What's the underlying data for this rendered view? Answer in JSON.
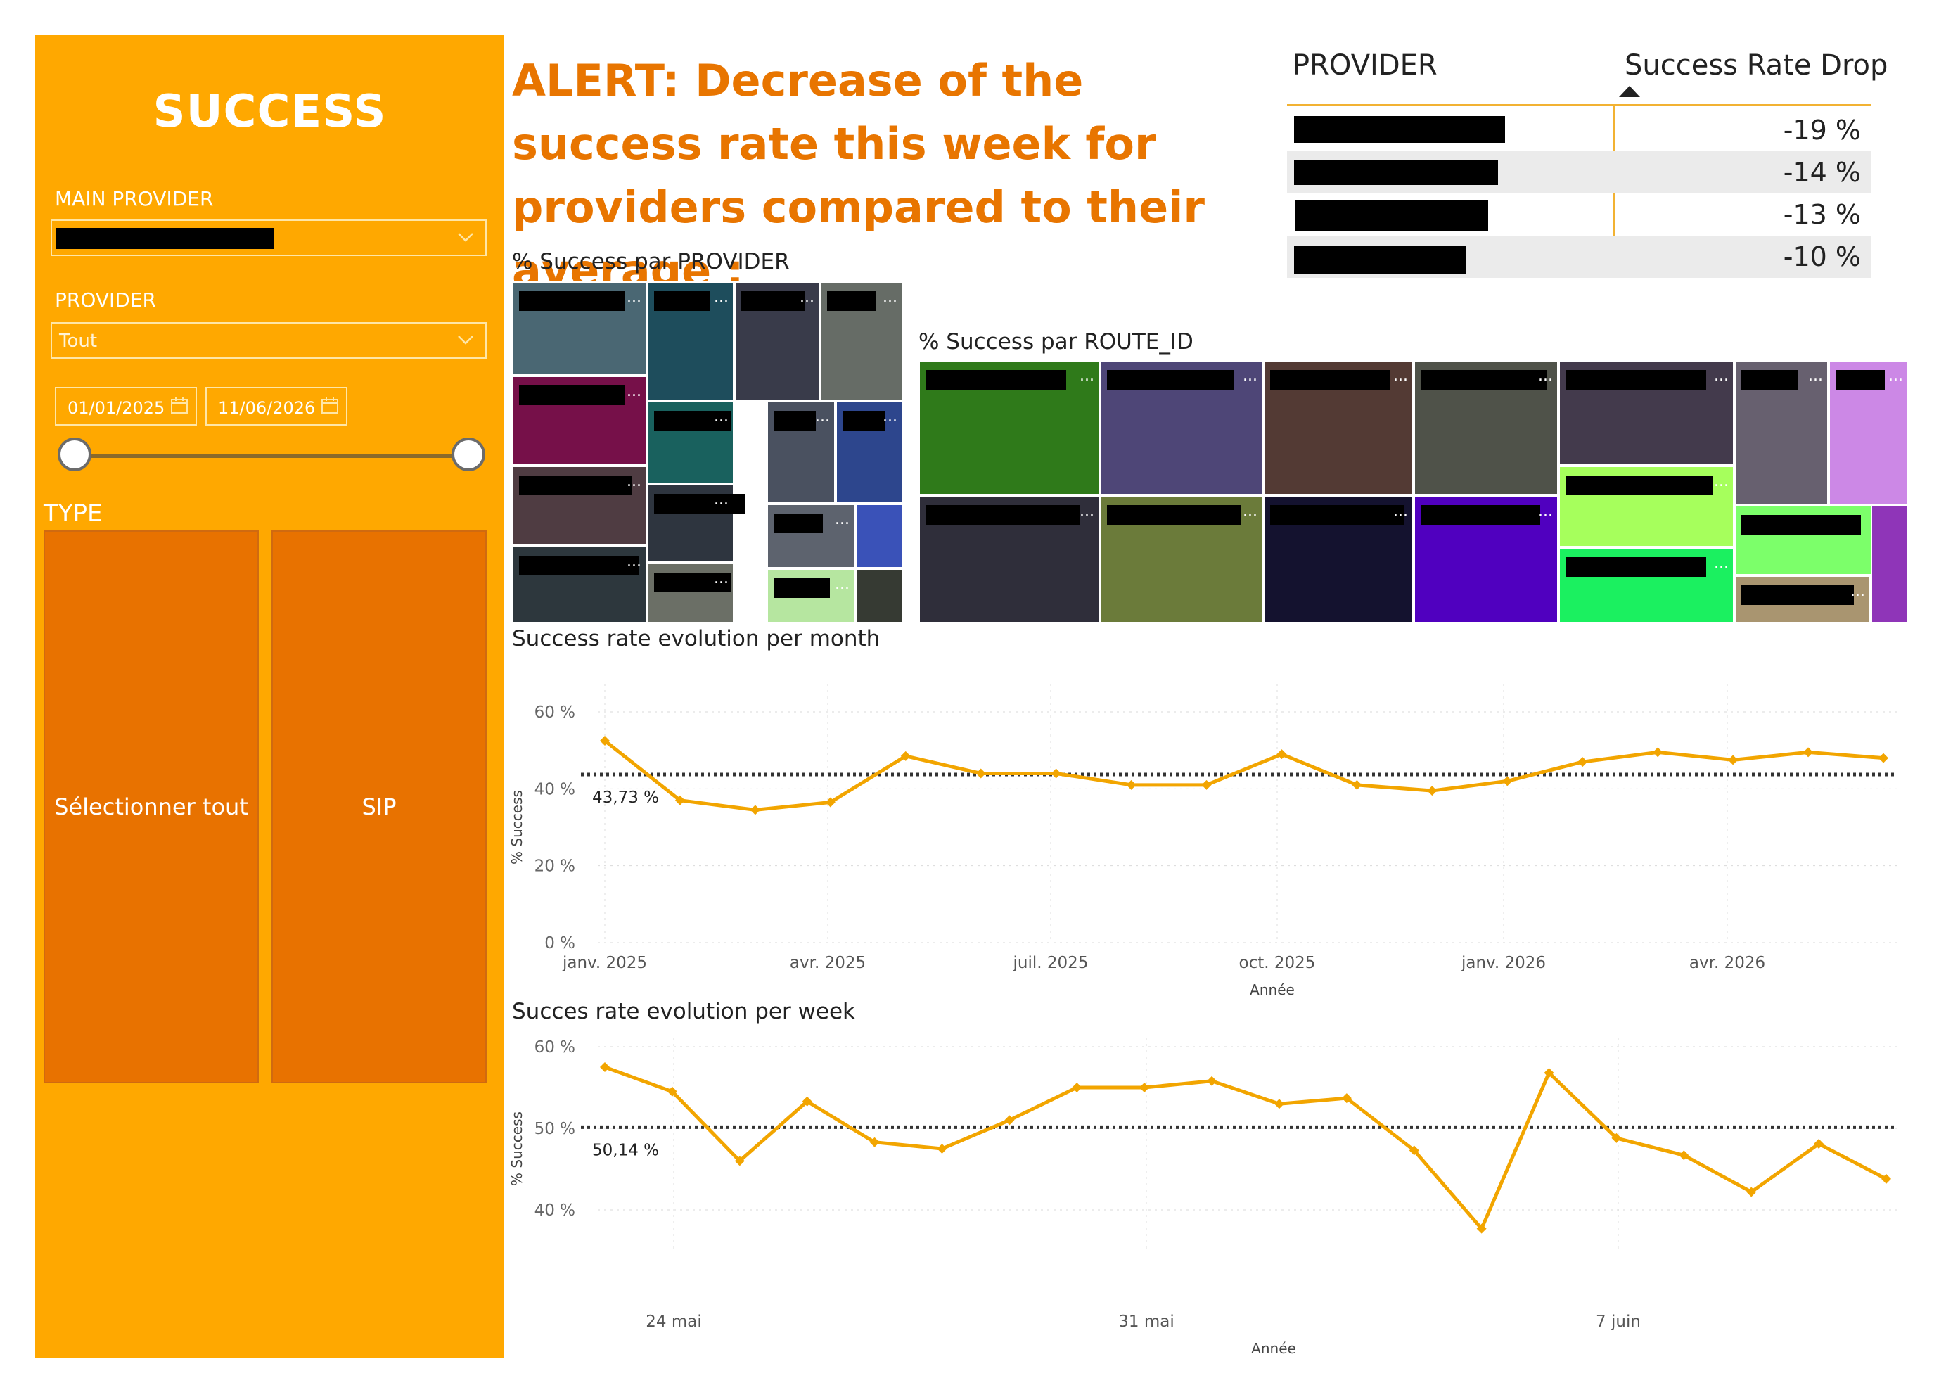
{
  "sidebar": {
    "title": "SUCCESS",
    "main_provider_label": "MAIN PROVIDER",
    "provider_label": "PROVIDER",
    "provider_value": "Tout",
    "date_start": "01/01/2025",
    "date_end": "11/06/2026",
    "type_label": "TYPE",
    "type_options": [
      "Sélectionner tout",
      "SIP"
    ]
  },
  "alert_text": "ALERT: Decrease of the success rate this week for providers compared to their average :",
  "drop_table": {
    "col_provider": "PROVIDER",
    "col_drop": "Success Rate Drop",
    "rows": [
      {
        "provider": "",
        "drop": "-19 %"
      },
      {
        "provider": "",
        "drop": "-14 %"
      },
      {
        "provider": "",
        "drop": "-13 %"
      },
      {
        "provider": "",
        "drop": "-10 %"
      }
    ]
  },
  "treemap_provider": {
    "title": "% Success par PROVIDER",
    "colors": [
      "#4A6773",
      "#761049",
      "#4F3C42",
      "#2D373D",
      "#1E4D5C",
      "#19615E",
      "#2E353F",
      "#6B6F66",
      "#393B4A",
      "#666C66",
      "#4A5160",
      "#2D468D",
      "#5D636E",
      "#3A52B8",
      "#B6E6A0",
      "#363A33"
    ]
  },
  "treemap_route": {
    "title": "% Success par ROUTE_ID",
    "colors": [
      "#2F7A1A",
      "#4E4677",
      "#533A34",
      "#4F5249",
      "#433A4C",
      "#67606F",
      "#CC88E6",
      "#2F2E3A",
      "#6B7B3A",
      "#14122F",
      "#5000BF",
      "#A6FF5C",
      "#1BF060",
      "#7CFF6A",
      "#A99570",
      "#8F35B8"
    ]
  },
  "chart_data": [
    {
      "type": "line",
      "title": "Success rate evolution per month",
      "xlabel": "Année",
      "ylabel": "% Success",
      "x_ticks": [
        "janv. 2025",
        "avr. 2025",
        "juil. 2025",
        "oct. 2025",
        "janv. 2026",
        "avr. 2026"
      ],
      "y_ticks": [
        "0 %",
        "20 %",
        "40 %",
        "60 %"
      ],
      "ylim": [
        0,
        60
      ],
      "x": [
        "2025-01",
        "2025-02",
        "2025-03",
        "2025-04",
        "2025-05",
        "2025-06",
        "2025-07",
        "2025-08",
        "2025-09",
        "2025-10",
        "2025-11",
        "2025-12",
        "2026-01",
        "2026-02",
        "2026-03",
        "2026-04",
        "2026-05",
        "2026-06"
      ],
      "values": [
        52.5,
        37,
        34.5,
        36.5,
        48.5,
        44,
        44,
        41,
        41,
        49,
        41,
        39.5,
        42,
        47,
        49.5,
        47.5,
        49.5,
        48
      ],
      "average": 43.73,
      "average_label": "43,73 %",
      "line_color": "#F2A500",
      "average_color": "#333333"
    },
    {
      "type": "line",
      "title": "Succes rate evolution per week",
      "xlabel": "Année",
      "ylabel": "% Success",
      "x_ticks": [
        "24 mai",
        "31 mai",
        "7 juin"
      ],
      "y_ticks": [
        "40 %",
        "50 %",
        "60 %"
      ],
      "ylim": [
        35,
        60
      ],
      "x": [
        "2026-05-23",
        "2026-05-24",
        "2026-05-25",
        "2026-05-26",
        "2026-05-27",
        "2026-05-28",
        "2026-05-29",
        "2026-05-30",
        "2026-05-31",
        "2026-06-01",
        "2026-06-02",
        "2026-06-03",
        "2026-06-04",
        "2026-06-05",
        "2026-06-06",
        "2026-06-07",
        "2026-06-08",
        "2026-06-09",
        "2026-06-10",
        "2026-06-11"
      ],
      "values": [
        57.5,
        54.5,
        46,
        53.3,
        48.3,
        47.5,
        51,
        55,
        55,
        55.8,
        53,
        53.7,
        47.3,
        37.7,
        56.8,
        48.8,
        46.7,
        42.2,
        48.1,
        43.8
      ],
      "average": 50.14,
      "average_label": "50,14 %",
      "line_color": "#F2A500",
      "average_color": "#333333"
    }
  ]
}
